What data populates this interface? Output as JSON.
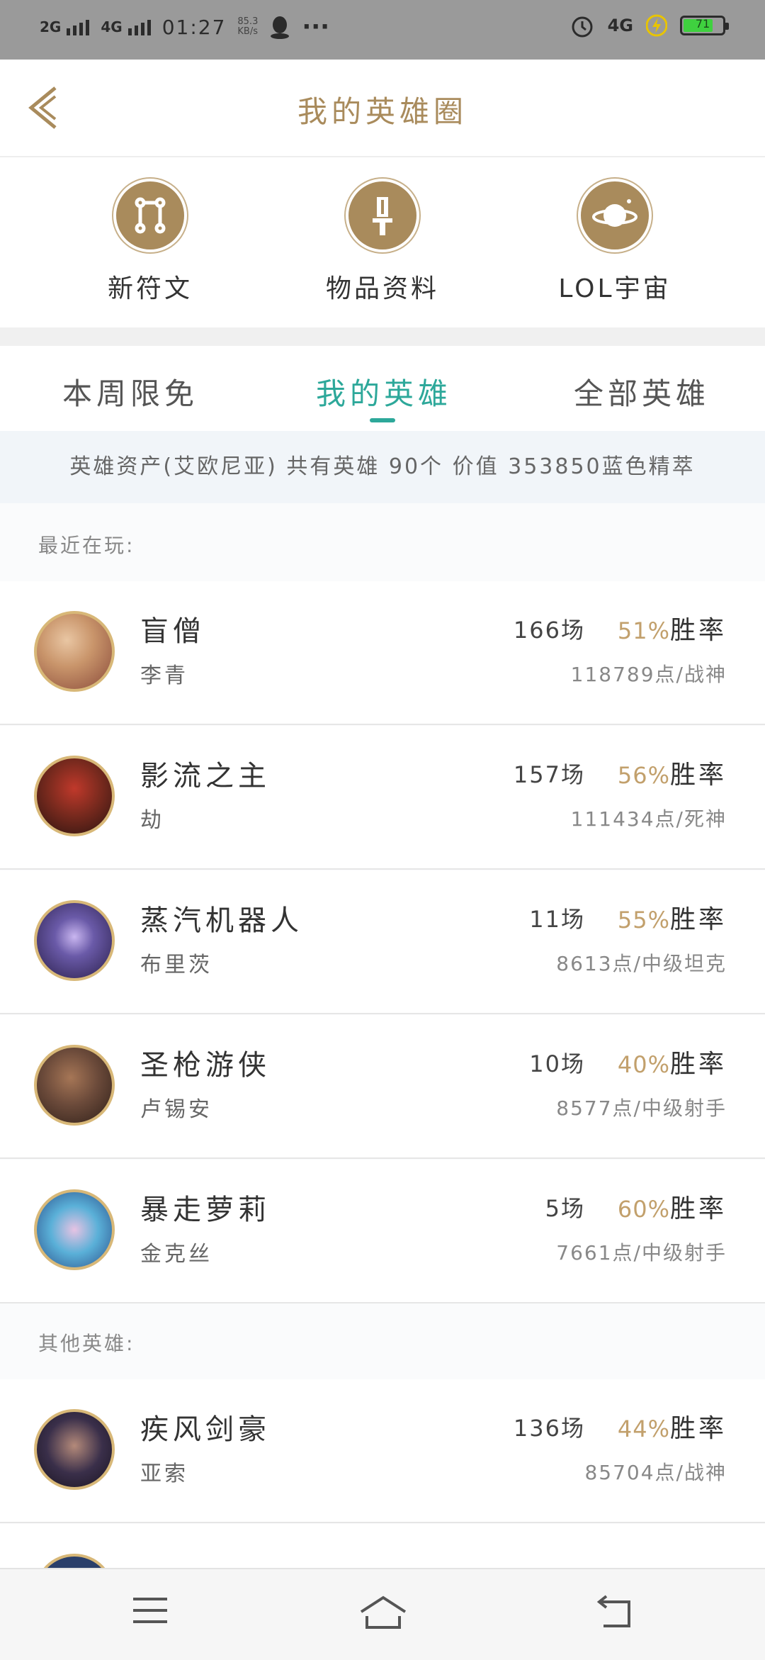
{
  "status_bar": {
    "signal1": "2G",
    "signal2": "4G",
    "time": "01:27",
    "speed": "85.3",
    "speed_unit": "KB/s",
    "more": "···",
    "net": "4G",
    "battery": "71"
  },
  "header": {
    "title": "我的英雄圈"
  },
  "shortcuts": [
    {
      "label": "新符文",
      "icon": "rune-icon"
    },
    {
      "label": "物品资料",
      "icon": "sword-icon"
    },
    {
      "label": "LOL宇宙",
      "icon": "planet-icon"
    }
  ],
  "tabs": [
    {
      "label": "本周限免",
      "active": false
    },
    {
      "label": "我的英雄",
      "active": true
    },
    {
      "label": "全部英雄",
      "active": false
    }
  ],
  "asset_summary": "英雄资产(艾欧尼亚)  共有英雄 90个  价值 353850蓝色精萃",
  "sections": {
    "recent": "最近在玩:",
    "other": "其他英雄:"
  },
  "heroes_recent": [
    {
      "title": "盲僧",
      "name": "李青",
      "games": "166场",
      "rate": "51%",
      "rate_suffix": "胜率",
      "points": "118789点/战神",
      "avatar_color": "#c9956b"
    },
    {
      "title": "影流之主",
      "name": "劫",
      "games": "157场",
      "rate": "56%",
      "rate_suffix": "胜率",
      "points": "111434点/死神",
      "avatar_color": "#7a2a1e"
    },
    {
      "title": "蒸汽机器人",
      "name": "布里茨",
      "games": "11场",
      "rate": "55%",
      "rate_suffix": "胜率",
      "points": "8613点/中级坦克",
      "avatar_color": "#4a3f7a"
    },
    {
      "title": "圣枪游侠",
      "name": "卢锡安",
      "games": "10场",
      "rate": "40%",
      "rate_suffix": "胜率",
      "points": "8577点/中级射手",
      "avatar_color": "#6b4a3a"
    },
    {
      "title": "暴走萝莉",
      "name": "金克丝",
      "games": "5场",
      "rate": "60%",
      "rate_suffix": "胜率",
      "points": "7661点/中级射手",
      "avatar_color": "#5ab0d8"
    }
  ],
  "heroes_other": [
    {
      "title": "疾风剑豪",
      "name": "亚索",
      "games": "136场",
      "rate": "44%",
      "rate_suffix": "胜率",
      "points": "85704点/战神",
      "avatar_color": "#3a2f4a"
    }
  ],
  "nav": {
    "menu": "menu-icon",
    "home": "home-icon",
    "back": "back-icon"
  }
}
